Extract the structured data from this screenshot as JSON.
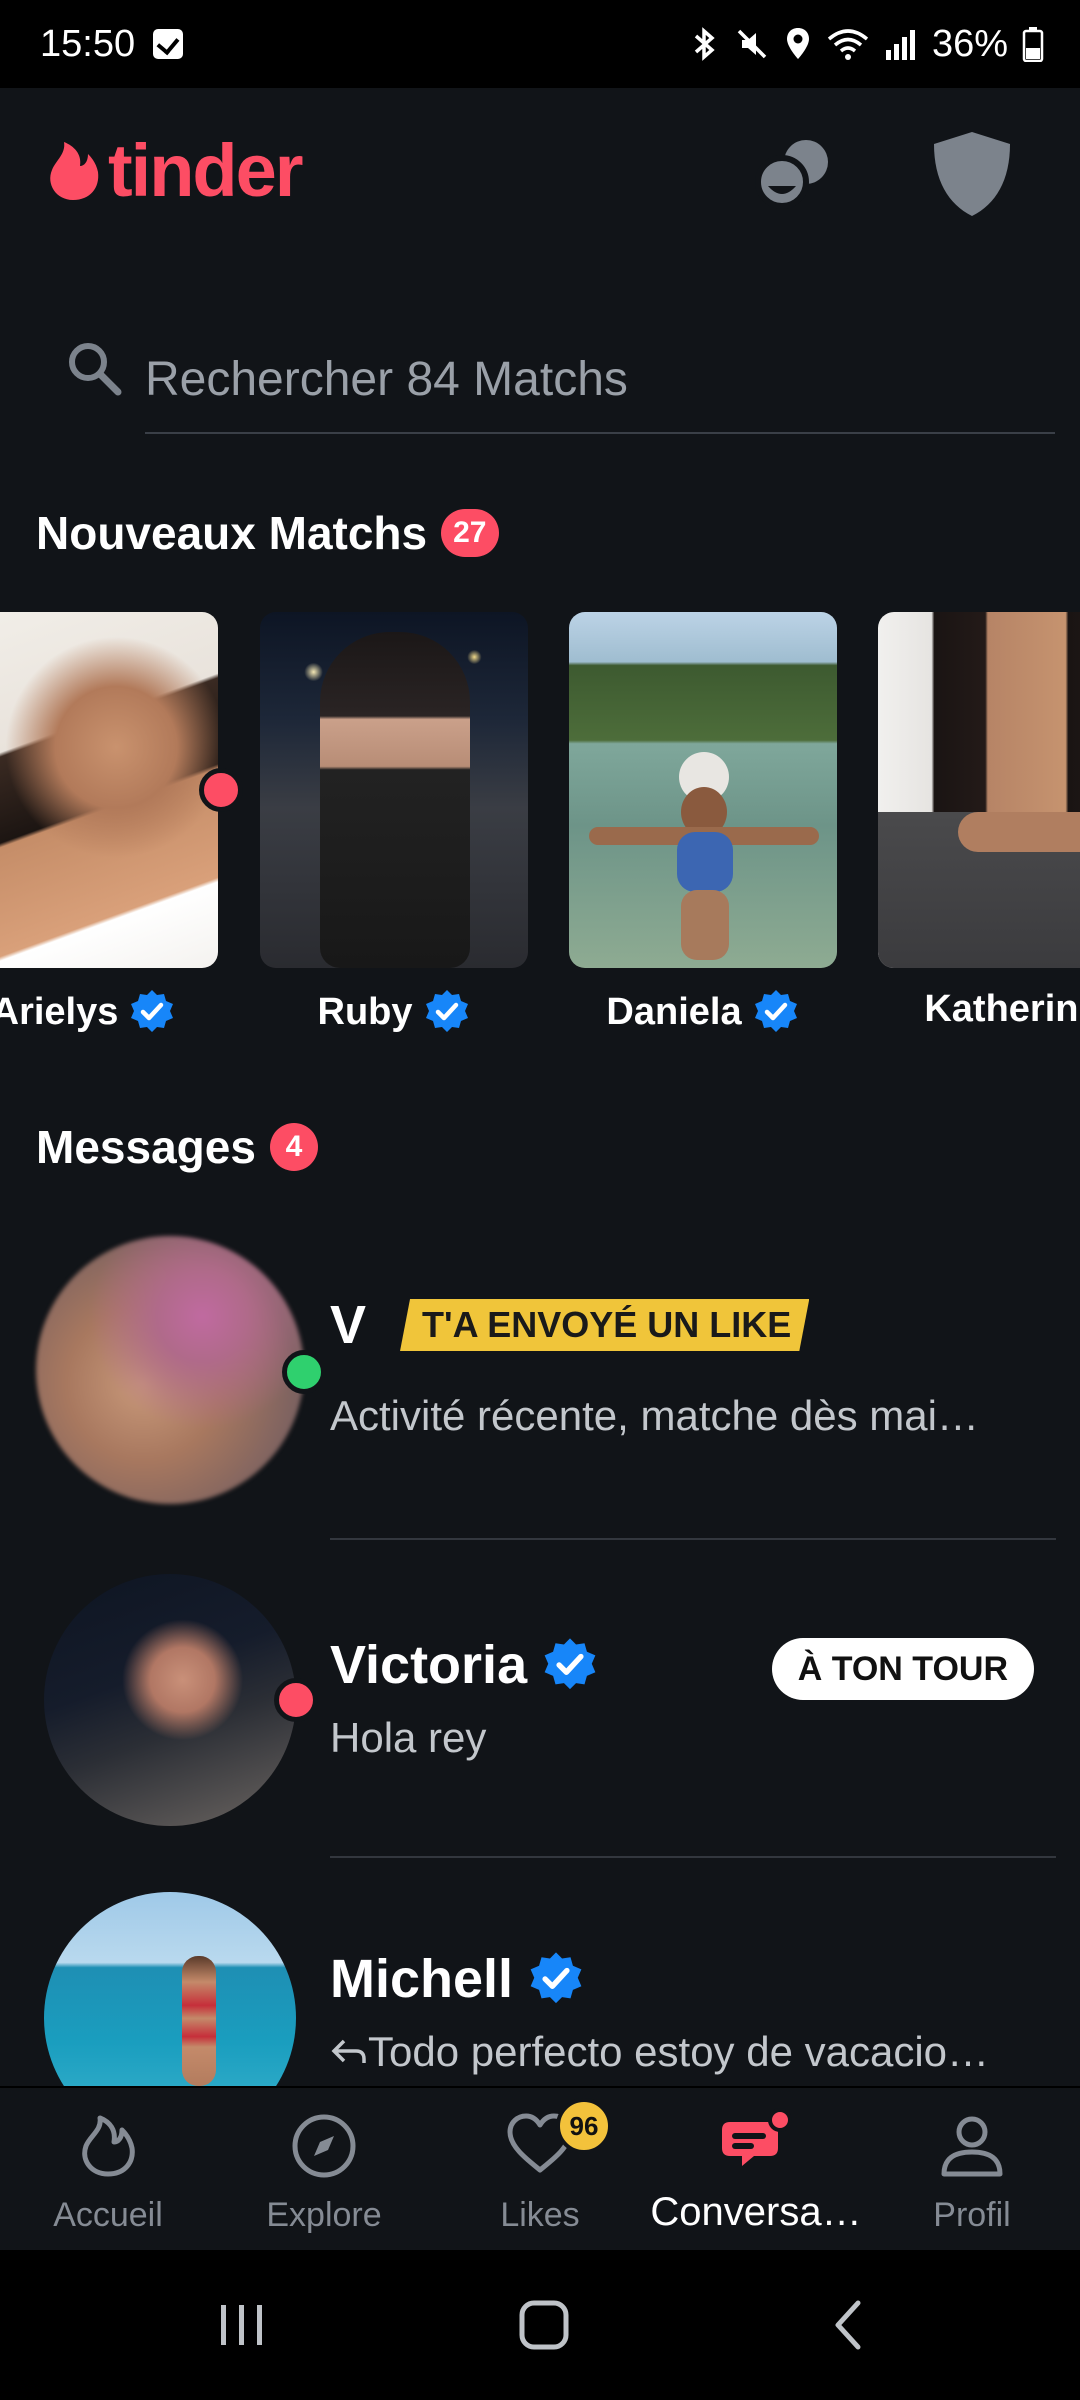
{
  "status_bar": {
    "time": "15:50",
    "battery": "36%"
  },
  "header": {
    "logo_text": "tinder",
    "brand_color": "#fd4d64"
  },
  "search": {
    "placeholder": "Rechercher 84 Matchs"
  },
  "new_matches": {
    "title": "Nouveaux Matchs",
    "count": "27",
    "items": [
      {
        "name": "Arielys",
        "verified": true,
        "online": true
      },
      {
        "name": "Ruby",
        "verified": true,
        "online": false
      },
      {
        "name": "Daniela",
        "verified": true,
        "online": false
      },
      {
        "name": "Katherine",
        "verified": false,
        "online": false
      }
    ]
  },
  "messages": {
    "title": "Messages",
    "count": "4",
    "items": [
      {
        "name": "V",
        "tag": "T'A ENVOYÉ UN LIKE",
        "preview": "Activité récente, matche dès mai…",
        "status": "online"
      },
      {
        "name": "Victoria",
        "verified": true,
        "preview": "Hola rey",
        "turn_label": "À TON TOUR",
        "status": "active"
      },
      {
        "name": "Michell",
        "verified": true,
        "preview": "Todo perfecto estoy de vacacio…"
      }
    ]
  },
  "bottom_nav": {
    "items": [
      {
        "label": "Accueil",
        "icon": "flame-icon"
      },
      {
        "label": "Explore",
        "icon": "compass-icon"
      },
      {
        "label": "Likes",
        "icon": "heart-icon",
        "badge": "96"
      },
      {
        "label": "Conversa…",
        "icon": "chat-icon",
        "active": true
      },
      {
        "label": "Profil",
        "icon": "person-icon"
      }
    ]
  }
}
